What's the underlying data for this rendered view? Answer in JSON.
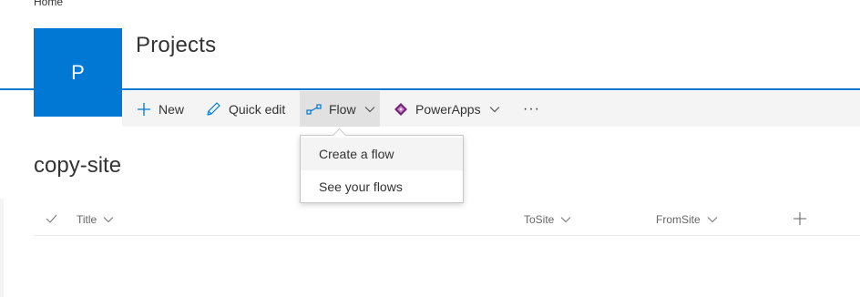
{
  "breadcrumb": {
    "label": "Home"
  },
  "site": {
    "logo_letter": "P",
    "title": "Projects",
    "accent_color": "#0078d4"
  },
  "command_bar": {
    "new_label": "New",
    "quick_edit_label": "Quick edit",
    "flow_label": "Flow",
    "powerapps_label": "PowerApps",
    "more_label": "···"
  },
  "flow_menu": {
    "items": [
      {
        "label": "Create a flow"
      },
      {
        "label": "See your flows"
      }
    ]
  },
  "list": {
    "title": "copy-site",
    "columns": [
      {
        "label": "Title"
      },
      {
        "label": "ToSite"
      },
      {
        "label": "FromSite"
      }
    ]
  },
  "icons": {
    "new": "plus-icon",
    "quick_edit": "pencil-icon",
    "flow": "flow-icon",
    "powerapps": "powerapps-icon",
    "add_column": "plus-icon",
    "select_all": "checkmark-icon"
  }
}
